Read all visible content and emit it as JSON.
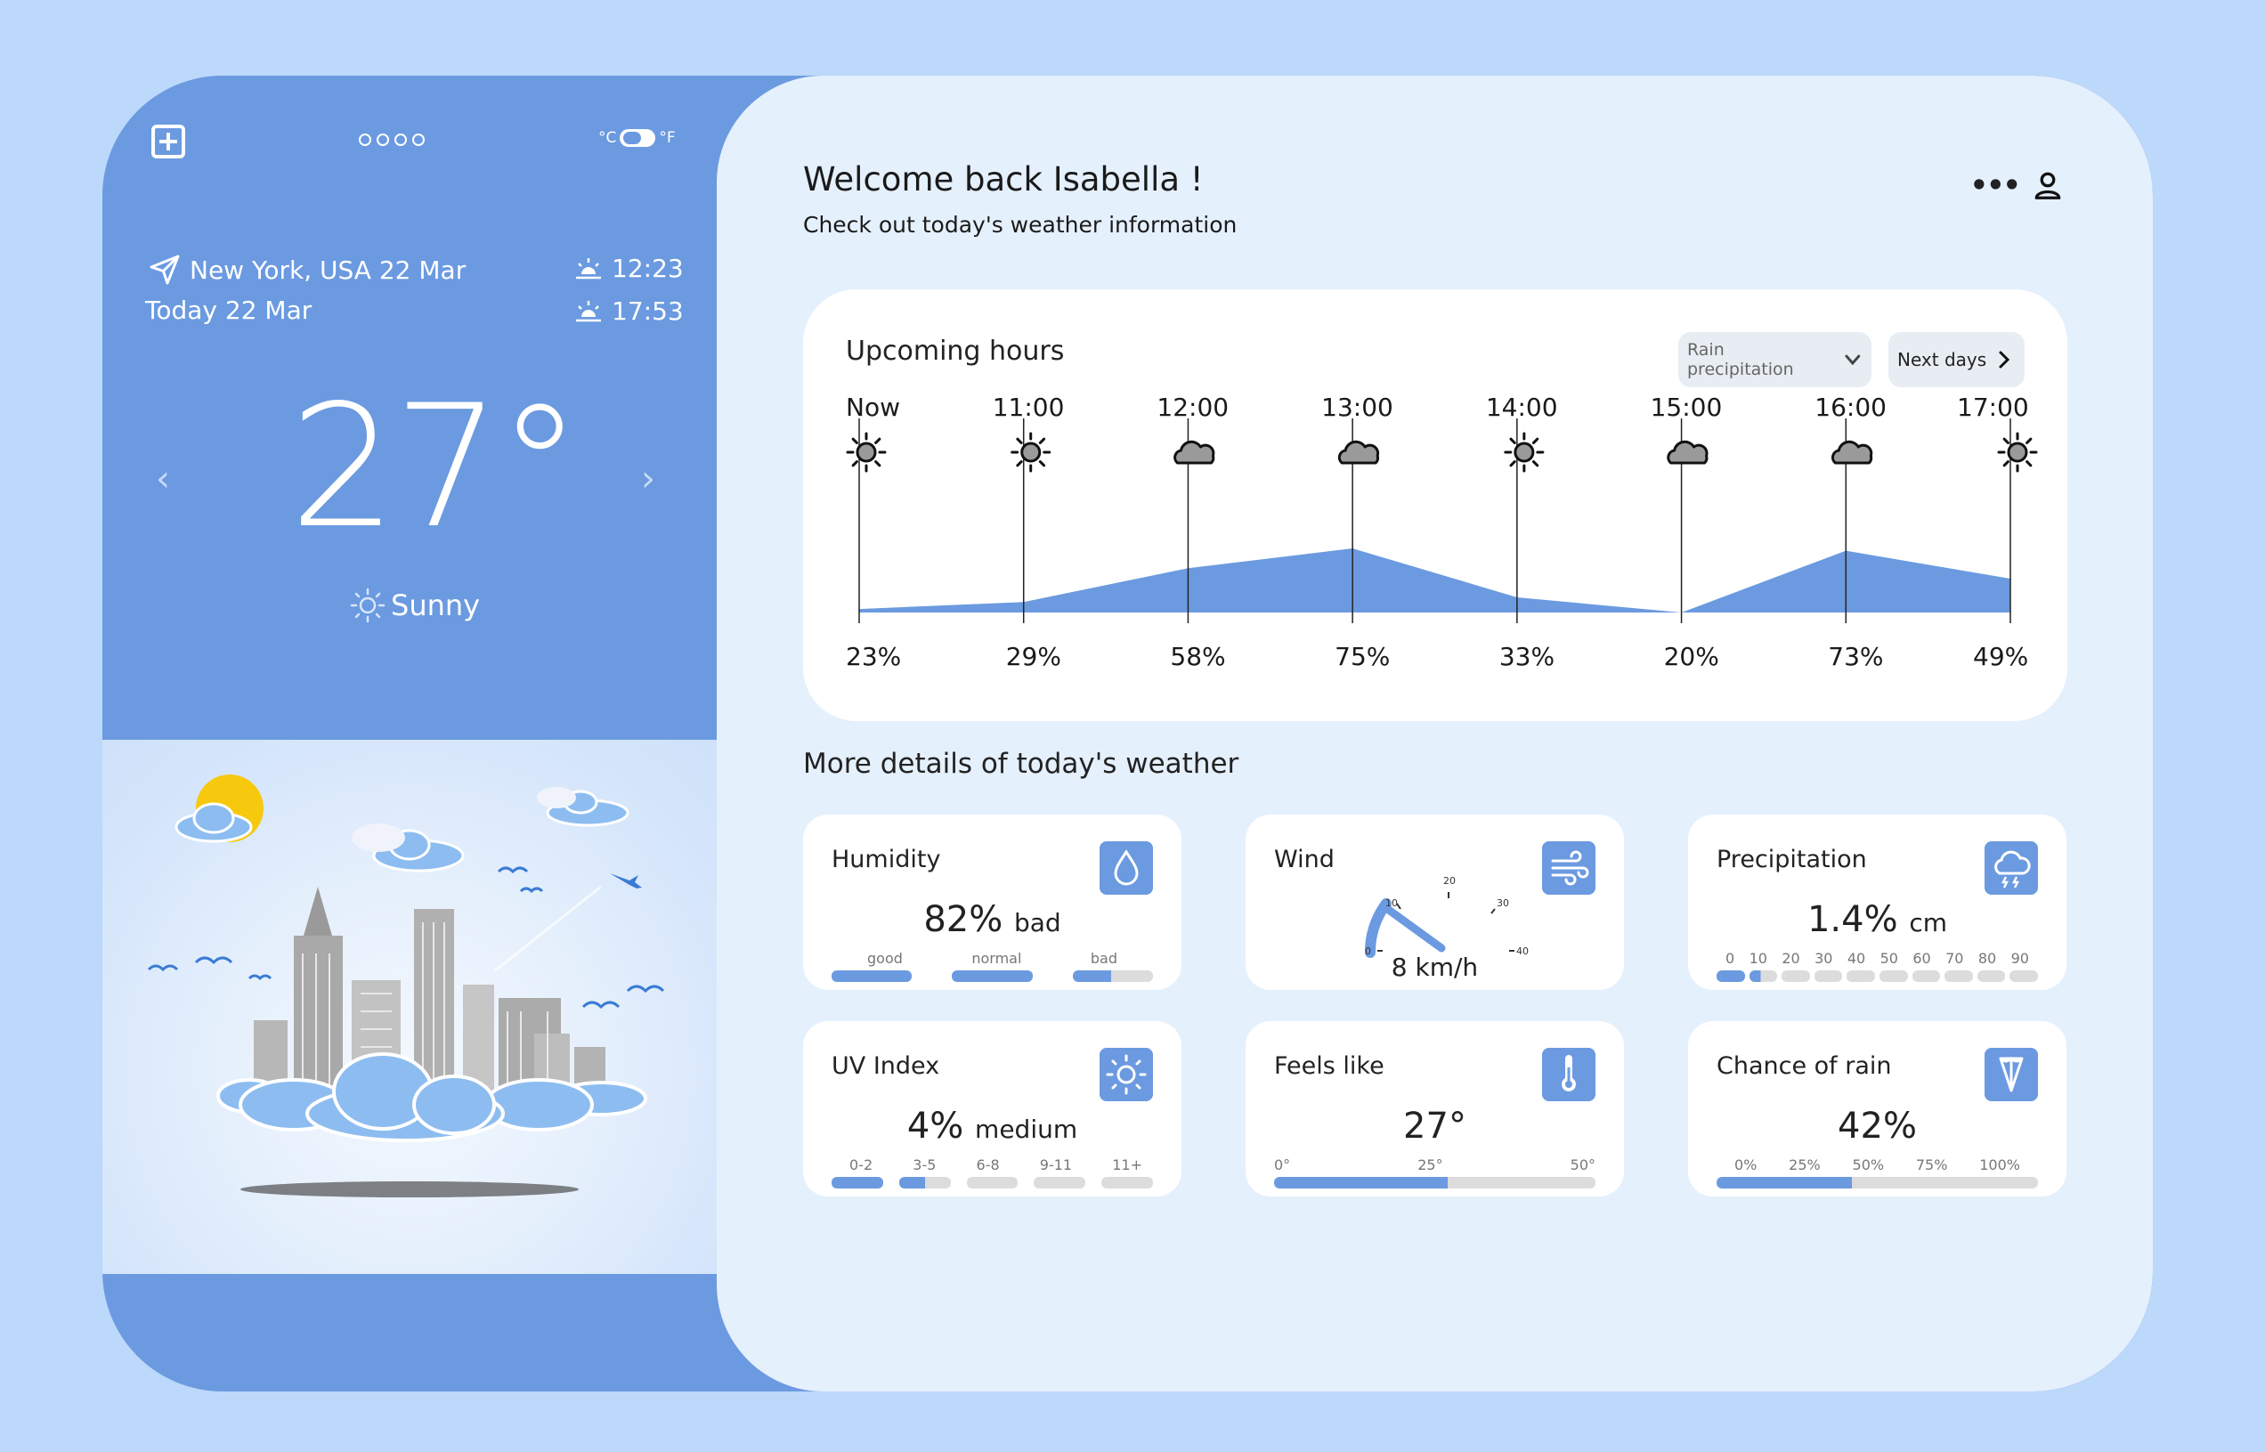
{
  "left": {
    "unit_c": "°C",
    "unit_f": "°F",
    "location": "New York, USA 22 Mar",
    "today": "Today 22 Mar",
    "sunrise": "12:23",
    "sunset": "17:53",
    "temperature": "27°",
    "condition": "Sunny",
    "pager_count": 4
  },
  "header": {
    "welcome": "Welcome back  Isabella !",
    "subtitle": "Check out today's weather information"
  },
  "hours": {
    "title": "Upcoming hours",
    "dropdown_label": "Rain precipitation",
    "next_days_label": "Next days",
    "items": [
      {
        "time": "Now",
        "icon": "sun-icon",
        "value": 23,
        "label": "23%"
      },
      {
        "time": "11:00",
        "icon": "sun-icon",
        "value": 29,
        "label": "29%"
      },
      {
        "time": "12:00",
        "icon": "cloud-icon",
        "value": 58,
        "label": "58%"
      },
      {
        "time": "13:00",
        "icon": "cloud-icon",
        "value": 75,
        "label": "75%"
      },
      {
        "time": "14:00",
        "icon": "sun-icon",
        "value": 33,
        "label": "33%"
      },
      {
        "time": "15:00",
        "icon": "cloud-icon",
        "value": 20,
        "label": "20%"
      },
      {
        "time": "16:00",
        "icon": "cloud-icon",
        "value": 73,
        "label": "73%"
      },
      {
        "time": "17:00",
        "icon": "sun-icon",
        "value": 49,
        "label": "49%"
      }
    ]
  },
  "details": {
    "title": "More details of today's weather",
    "humidity": {
      "title": "Humidity",
      "value": "82%",
      "qualifier": "bad",
      "scale": [
        "good",
        "normal",
        "bad"
      ],
      "level": 0.82
    },
    "wind": {
      "title": "Wind",
      "value": "8 km/h",
      "ticks": [
        "0",
        "10",
        "20",
        "30",
        "40"
      ],
      "speed": 8
    },
    "precipitation": {
      "title": "Precipitation",
      "value": "1.4%",
      "unit": "cm",
      "scale": [
        "0",
        "10",
        "20",
        "30",
        "40",
        "50",
        "60",
        "70",
        "80",
        "90"
      ],
      "level": 0.14
    },
    "uv": {
      "title": "UV Index",
      "value": "4%",
      "qualifier": "medium",
      "scale": [
        "0-2",
        "3-5",
        "6-8",
        "9-11",
        "11+"
      ],
      "level": 0.22
    },
    "feels": {
      "title": "Feels like",
      "value": "27°",
      "scale": [
        "0°",
        "25°",
        "50°"
      ],
      "level": 0.54
    },
    "rain": {
      "title": "Chance of rain",
      "value": "42%",
      "scale": [
        "0%",
        "25%",
        "50%",
        "75%",
        "100%"
      ],
      "level": 0.42
    }
  },
  "colors": {
    "accent": "#6b9ae0",
    "background": "#bcd8fa",
    "panel": "#e5f0fd"
  }
}
